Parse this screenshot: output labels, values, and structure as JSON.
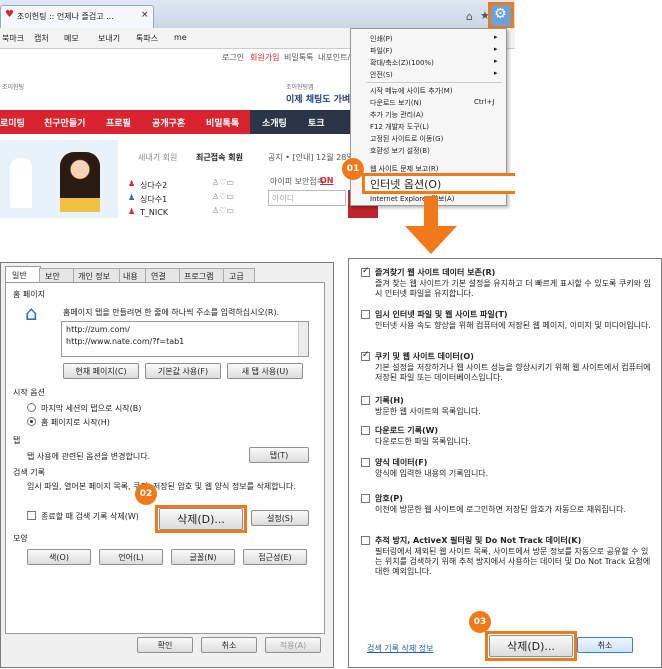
{
  "browser": {
    "tab_title": "조이헌팅 :: 언제나 즐겁고 ...",
    "favorites_bar": [
      "북마크",
      "캡처",
      "메모",
      "보내기",
      "톡파스",
      "me"
    ],
    "top_links": [
      "로그인",
      "회원가입",
      "비밀톡톡",
      "내포인트/충"
    ],
    "logo_text": "조이헌팅",
    "banner_small": "조이헌팅앱",
    "banner": "이제 채팅도 가벼",
    "nav": [
      "로미팅",
      "친구만들기",
      "프로필",
      "공개구혼",
      "비밀톡톡",
      "소개팅",
      "토크"
    ],
    "member_tabs": [
      "새내기 회원",
      "최근접속 회원"
    ],
    "members": [
      "싱다수2",
      "싱다수1",
      "T_NICK"
    ],
    "notice": "공지 • [안내] 12월 28일 (",
    "myinfo_label": "아이피 보안접속",
    "myinfo_on": "ON",
    "id_placeholder": "아이디"
  },
  "tools_menu": {
    "items": [
      "인쇄(P)",
      "파일(F)",
      "확대/축소(Z)(100%)",
      "안전(S)",
      "시작 메뉴에 사이트 추가(M)",
      "다운로드 보기(N)",
      "추가 기능 관리(A)",
      "F12 개발자 도구(L)",
      "고정된 사이트로 이동(G)",
      "호환성 보기 설정(B)",
      "웹 사이트 문제 보고(R)",
      "인터넷 옵션(O)",
      "Internet Explorer 정보(A)"
    ],
    "download_shortcut": "Ctrl+J"
  },
  "badges": {
    "step1": "01",
    "step2": "02",
    "step3": "03"
  },
  "internet_options": {
    "tabs": [
      "일반",
      "보안",
      "개인 정보",
      "내용",
      "연결",
      "프로그램",
      "고급"
    ],
    "homepage_title": "홈 페이지",
    "homepage_desc": "홈페이지 탭을 만들려면 한 줄에 하나씩 주소를 입력하십시오(R).",
    "homepage_urls": [
      "http://zum.com/",
      "http://www.nate.com/?f=tab1"
    ],
    "btn_current": "현재 페이지(C)",
    "btn_default": "기본값 사용(F)",
    "btn_newtab": "새 탭 사용(U)",
    "startup_title": "시작 옵션",
    "startup_last": "마지막 세션의 탭으로 시작(B)",
    "startup_home": "홈 페이지로 시작(H)",
    "tabs_title": "탭",
    "tabs_desc": "탭 사용에 관련된 옵션을 변경합니다.",
    "btn_tabs": "탭(T)",
    "history_title": "검색 기록",
    "history_desc": "임시 파일, 열어본 페이지 목록, 쿠키, 저장된 암호 및 웹 양식 정보를 삭제합니다.",
    "history_exit": "종료할 때 검색 기록 삭제(W)",
    "btn_delete": "삭제(D)...",
    "btn_settings": "설정(S)",
    "appearance_title": "모양",
    "btn_colors": "색(O)",
    "btn_languages": "언어(L)",
    "btn_fonts": "글꼴(N)",
    "btn_access": "접근성(E)",
    "btn_ok": "확인",
    "btn_cancel": "취소",
    "btn_apply": "적용(A)"
  },
  "delete_history": {
    "items": [
      {
        "title": "즐겨찾기 웹 사이트 데이터 보존(R)",
        "checked": true,
        "desc": "즐겨 찾는 웹 사이트가 기본 설정을 유지하고 더 빠르게 표시할 수 있도록 쿠키와 임시 인터넷 파일을 유지합니다."
      },
      {
        "title": "임시 인터넷 파일 및 웹 사이트 파일(T)",
        "checked": false,
        "desc": "인터넷 사용 속도 향상을 위해 컴퓨터에 저장된 웹 페이지, 이미지 및 미디어입니다."
      },
      {
        "title": "쿠키 및 웹 사이트 데이터(O)",
        "checked": true,
        "desc": "기본 설정을 저장하거나 웹 사이트 성능을 향상시키기 위해 웹 사이트에서 컴퓨터에 저장된 파일 또는 데이터베이스입니다."
      },
      {
        "title": "기록(H)",
        "checked": false,
        "desc": "방문한 웹 사이트의 목록입니다."
      },
      {
        "title": "다운로드 기록(W)",
        "checked": false,
        "desc": "다운로드한 파일 목록입니다."
      },
      {
        "title": "양식 데이터(F)",
        "checked": false,
        "desc": "양식에 입력한 내용의 기록입니다."
      },
      {
        "title": "암호(P)",
        "checked": false,
        "desc": "이전에 방문한 웹 사이트에 로그인하면 저장된 암호가 자동으로 채워집니다."
      },
      {
        "title": "추적 방지, ActiveX 필터링 및 Do Not Track 데이터(K)",
        "checked": false,
        "desc": "필터링에서 제외된 웹 사이트 목록, 사이트에서 방문 정보를 자동으로 공유할 수 있는 위치를 검색하기 위해 추적 방지에서 사용하는 데이터 및 Do Not Track 요청에 대한 예외입니다."
      }
    ],
    "about_link": "검색 기록 삭제 정보",
    "btn_delete": "삭제(D)...",
    "btn_cancel": "취소"
  },
  "colors": {
    "accent": "#f07a1a",
    "nav_red": "#d9232e",
    "link": "#1f5fa8"
  }
}
